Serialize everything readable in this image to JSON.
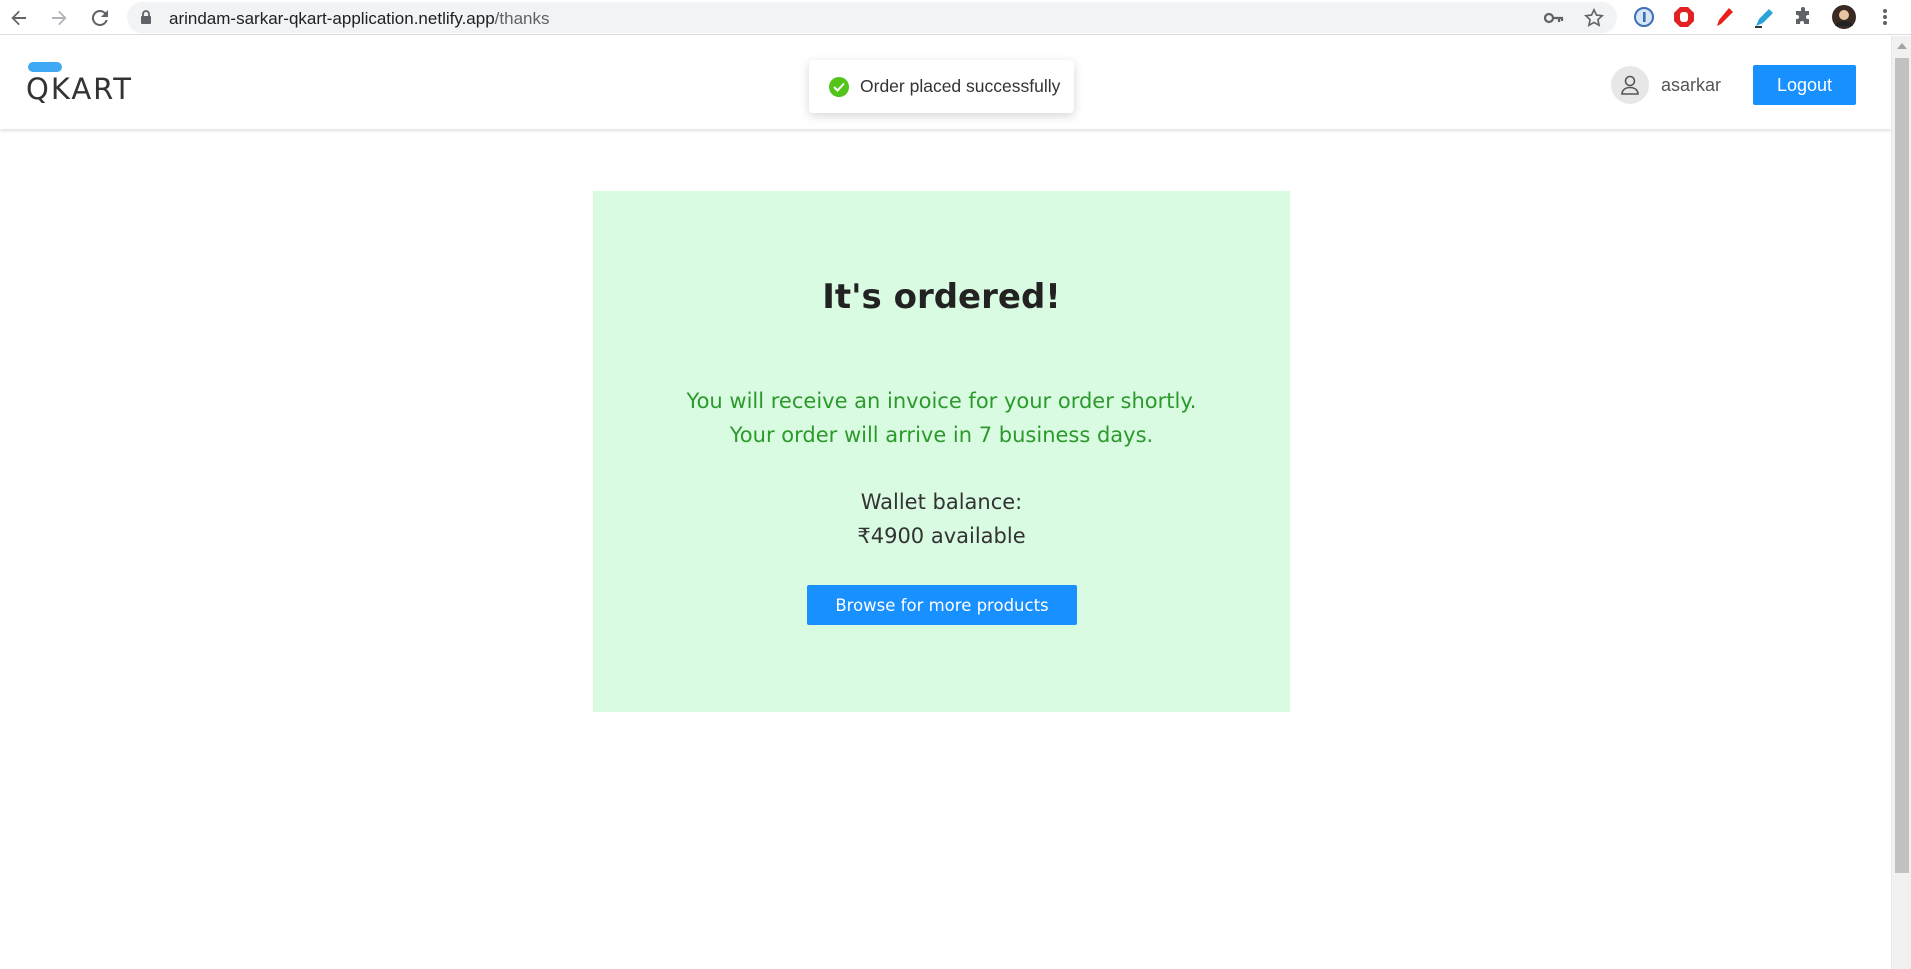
{
  "browser": {
    "url_host": "arindam-sarkar-qkart-application.netlify.app",
    "url_path": "/thanks",
    "icons": [
      "back-icon",
      "forward-icon",
      "reload-icon",
      "lock-icon",
      "key-icon",
      "bookmark-star-icon",
      "extension-1password-icon",
      "extension-adblock-icon",
      "extension-pen-icon",
      "extension-highlighter-icon",
      "extensions-puzzle-icon",
      "profile-avatar-icon",
      "kebab-menu-icon"
    ]
  },
  "header": {
    "logo_text": "QKART",
    "username": "asarkar",
    "logout_label": "Logout",
    "accent": "#1890ff",
    "logo_pill_color": "#3fa9f5"
  },
  "toast": {
    "message": "Order placed successfully",
    "status_color": "#52c41a"
  },
  "card": {
    "background": "#d9fbe2",
    "title": "It's ordered!",
    "message_line1": "You will receive an invoice for your order shortly.",
    "message_line2": "Your order will arrive in 7 business days.",
    "wallet_label": "Wallet balance:",
    "wallet_amount": "₹4900 available",
    "browse_label": "Browse for more products"
  }
}
